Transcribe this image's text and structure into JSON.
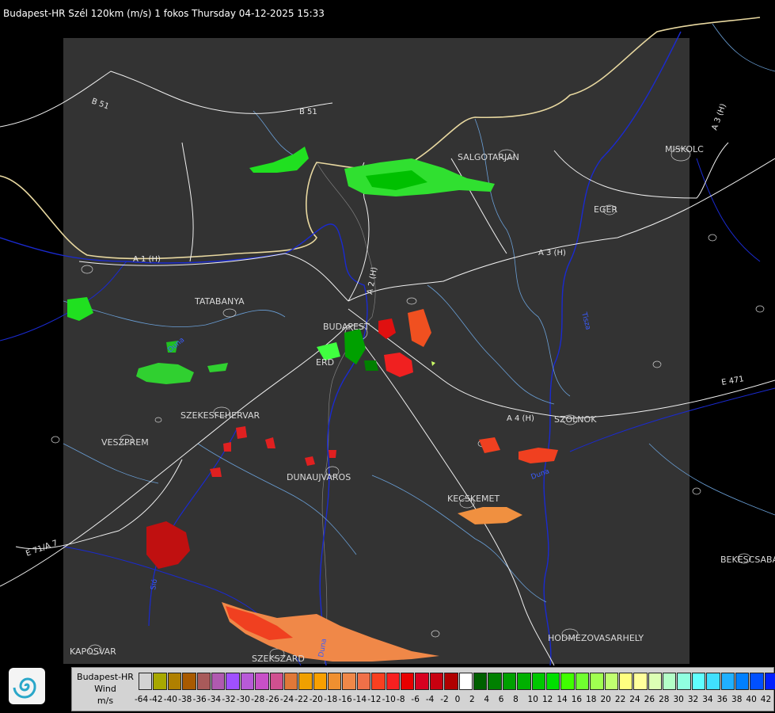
{
  "header": {
    "title": "Budapest-HR Szél 120km (m/s) 1 fokos Thursday 04-12-2025 15:33"
  },
  "map": {
    "cities": [
      "SALGOTARJAN",
      "EGER",
      "MISKOLC",
      "TATABANYA",
      "BUDAPEST",
      "ERD",
      "SZEKESFEHERVAR",
      "VESZPREM",
      "DUNAUJVAROS",
      "KECSKEMET",
      "SZOLNOK",
      "BEKESCSABA",
      "HODMEZOVASARHELY",
      "KAPOSVAR",
      "SZEKSZARD"
    ],
    "roads": [
      "B 51",
      "B 51",
      "A 3 (H)",
      "A 3 (H)",
      "A 1 (H)",
      "A 2 (H)",
      "A 4 (H)",
      "E 471",
      "E 71/A 7"
    ],
    "rivers": [
      "Duna",
      "Tisza",
      "Sió",
      "Duna",
      "Duna"
    ]
  },
  "legend": {
    "line1": "Budapest-HR",
    "line2": "Wind",
    "line3": "m/s",
    "colors": [
      "#d3d3d3",
      "#a8a800",
      "#b08000",
      "#a85a00",
      "#a85a5a",
      "#b05ab0",
      "#a050ff",
      "#b85ad8",
      "#c850c8",
      "#d05090",
      "#e07838",
      "#f0a000",
      "#f8a000",
      "#f09030",
      "#f08848",
      "#f07048",
      "#f84020",
      "#f82020",
      "#e80000",
      "#d80020",
      "#c80010",
      "#b00000",
      "#ffffff",
      "#006000",
      "#008000",
      "#00a000",
      "#00b000",
      "#00c800",
      "#00e000",
      "#40ff00",
      "#70ff30",
      "#a0ff50",
      "#c0ff70",
      "#ffff80",
      "#ffff9c",
      "#dcffb4",
      "#b4ffc8",
      "#90ffe0",
      "#60ffff",
      "#40e0ff",
      "#20b0ff",
      "#0080ff",
      "#0050ff",
      "#0020ff"
    ],
    "ticks": [
      "-64",
      "-42",
      "-40",
      "-38",
      "-36",
      "-34",
      "-32",
      "-30",
      "-28",
      "-26",
      "-24",
      "-22",
      "-20",
      "-18",
      "-16",
      "-14",
      "-12",
      "-10",
      "-8",
      "-6",
      "-4",
      "-2",
      "0",
      "2",
      "4",
      "6",
      "8",
      "10",
      "12",
      "14",
      "16",
      "18",
      "20",
      "22",
      "24",
      "26",
      "28",
      "30",
      "32",
      "34",
      "36",
      "38",
      "40",
      "42"
    ]
  }
}
